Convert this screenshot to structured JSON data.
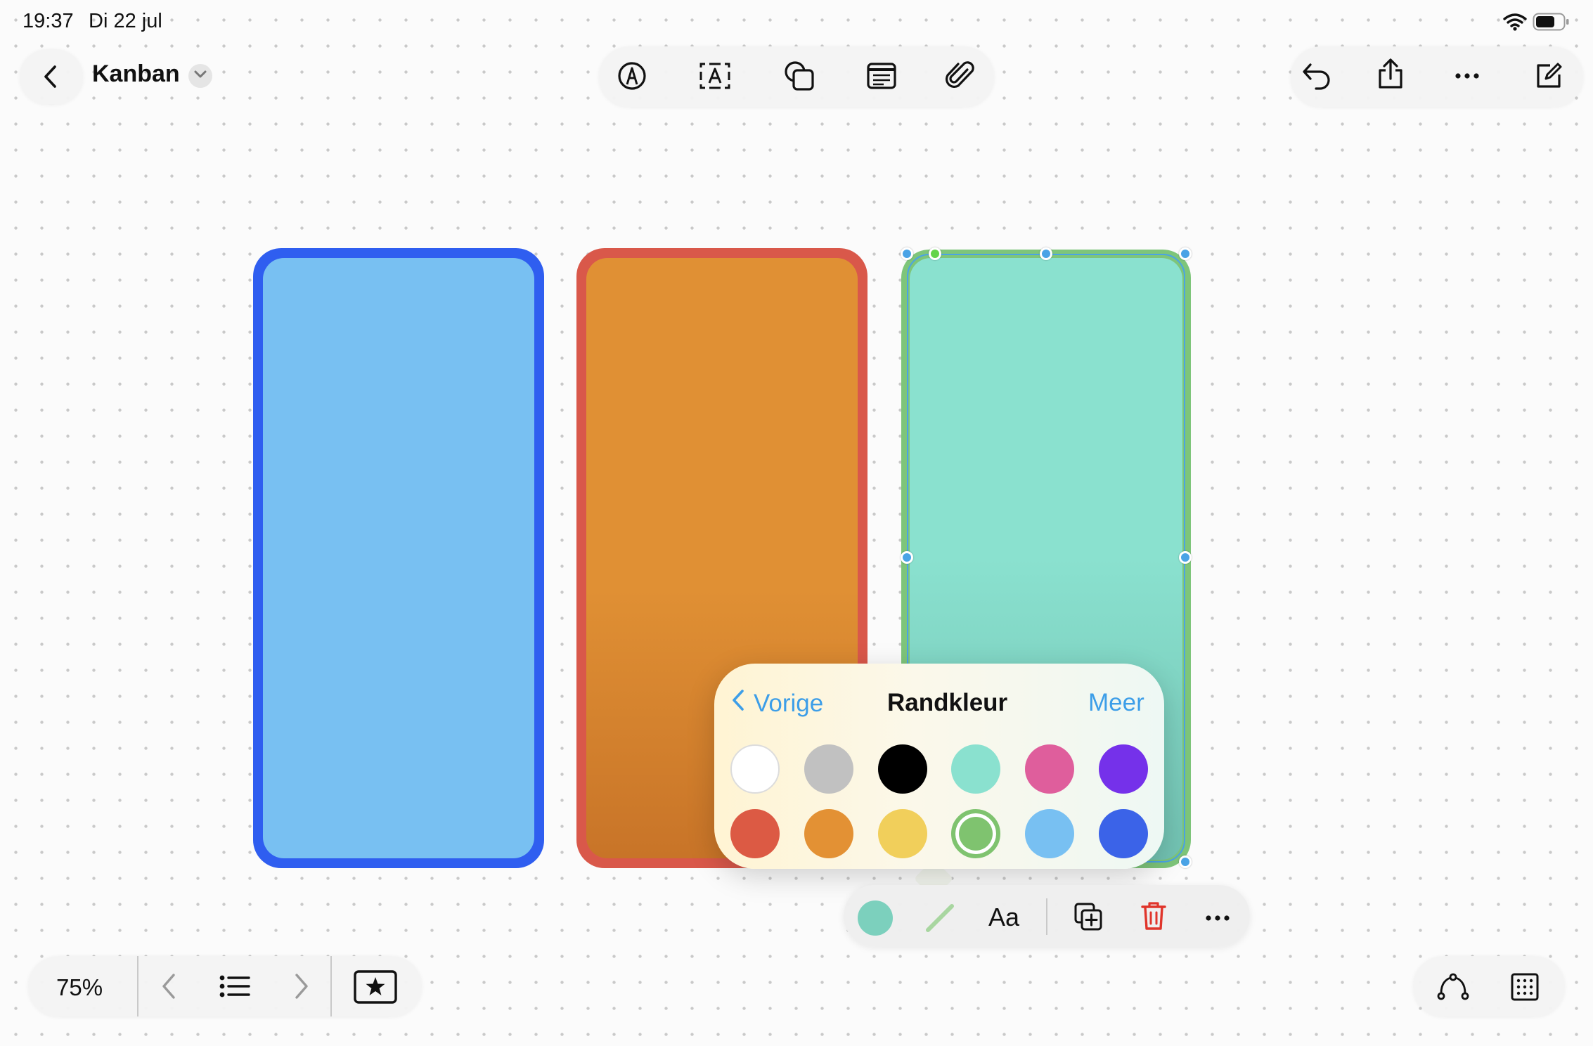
{
  "status_bar": {
    "time": "19:37",
    "date": "Di 22 jul",
    "icons": [
      "wifi-icon",
      "battery-icon"
    ]
  },
  "header": {
    "title": "Kanban",
    "icons": [
      "back-icon",
      "chevron-down-icon",
      "pen-icon",
      "text-box-icon",
      "shapes-icon",
      "note-icon",
      "paperclip-icon",
      "undo-icon",
      "share-icon",
      "more-icon",
      "compose-icon"
    ]
  },
  "canvas": {
    "columns": [
      {
        "name": "blue",
        "fill": "#78c0f2",
        "border": "#2f5ef0"
      },
      {
        "name": "orange",
        "fill": "#e09034",
        "border": "#d9584a"
      },
      {
        "name": "mint",
        "fill": "#8ae1cf",
        "border": "#7ec57a"
      }
    ]
  },
  "border_color_popover": {
    "back_label": "Vorige",
    "title": "Randkleur",
    "more_label": "Meer",
    "colors": [
      [
        "#ffffff",
        "#c1c1c1",
        "#000000",
        "#8ae1cf",
        "#df5e9c",
        "#7531ea"
      ],
      [
        "#dc5a44",
        "#e39134",
        "#f1cf5b",
        "#7fc36f",
        "#78c0f2",
        "#3b63e8"
      ]
    ],
    "selected": "#7fc36f"
  },
  "shape_toolbar": {
    "fill_color": "#7cd0bd",
    "text_style_label": "Aa",
    "icons": [
      "fill-color-icon",
      "border-stroke-icon",
      "text-style-icon",
      "duplicate-icon",
      "trash-icon",
      "more-icon"
    ]
  },
  "bottom_bar": {
    "zoom": "75%",
    "icons": [
      "previous-icon",
      "list-icon",
      "next-icon",
      "favorites-icon",
      "connector-icon",
      "grid-icon"
    ]
  }
}
